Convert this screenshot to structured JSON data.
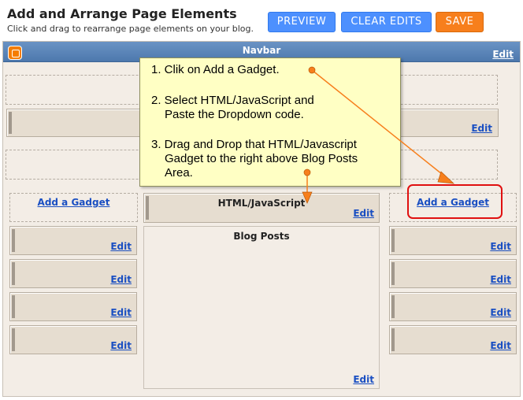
{
  "header": {
    "title": "Add and Arrange Page Elements",
    "subtitle": "Click and drag to rearrange page elements on your blog."
  },
  "toolbar": {
    "preview_label": "PREVIEW",
    "clear_label": "CLEAR EDITS",
    "save_label": "SAVE",
    "colors": {
      "blue": "#4d90fe",
      "orange": "#f77f1c"
    }
  },
  "navbar": {
    "title": "Navbar",
    "edit_label": "Edit",
    "icon": "blogger-icon"
  },
  "layout": {
    "edit_label": "Edit",
    "add_gadget_label": "Add a Gadget",
    "main_gadget_title": "HTML/JavaScript",
    "blog_posts_title": "Blog Posts"
  },
  "callout": {
    "lines": [
      "1. Clik on Add a Gadget.",
      "2. Select HTML/JavaScript and",
      "Paste the Dropdown code.",
      "3. Drag and Drop that HTML/Javascript",
      "Gadget to the right above Blog Posts",
      "Area."
    ],
    "arrow_color": "#f77f1c",
    "highlight_color": "#e01010"
  }
}
